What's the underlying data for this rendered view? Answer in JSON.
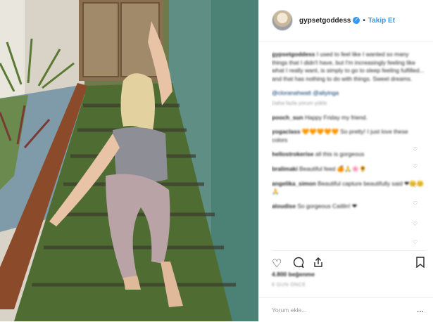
{
  "header": {
    "username": "gypsetgoddess",
    "verified_badge": "verified-icon",
    "separator": "•",
    "follow_label": "Takip Et"
  },
  "caption": {
    "user": "gypsetgoddess",
    "text": "I used to feel like I wanted so many things that I didn't have, but I'm increasingly feeling like what I really want, is simply to go to sleep feeling fulfilled... and that has nothing to do with things. Sweet dreams."
  },
  "tags": {
    "line": "@cloranahwatt @aliyinga",
    "sub": "Daha fazla yorum yükle"
  },
  "comments": [
    {
      "user": "pooch_sun",
      "text": "Happy Friday my friend."
    },
    {
      "user": "yogaclass",
      "text": "🧡🧡🧡🧡🧡 So pretty! I just love these colors"
    },
    {
      "user": "hellostrokerise",
      "text": "all this is gorgeous"
    },
    {
      "user": "bralimaki",
      "text": "Beautiful feed 🍊🙏🌸🌻"
    },
    {
      "user": "angelika_simon",
      "text": "Beautiful capture beautifully said ❤😊😊🙏"
    },
    {
      "user": "aloudise",
      "text": "So gorgeous Caitlin! ❤"
    }
  ],
  "actions": {
    "like_icon": "heart-icon",
    "comment_icon": "comment-icon",
    "share_icon": "share-icon",
    "save_icon": "bookmark-icon"
  },
  "likes": "4.800 beğenme",
  "date": "6 GÜN ÖNCE",
  "add_comment": {
    "placeholder": "Yorum ekle...",
    "more": "..."
  },
  "colors": {
    "accent": "#3897f0",
    "border": "#efefef",
    "muted": "#999999"
  }
}
